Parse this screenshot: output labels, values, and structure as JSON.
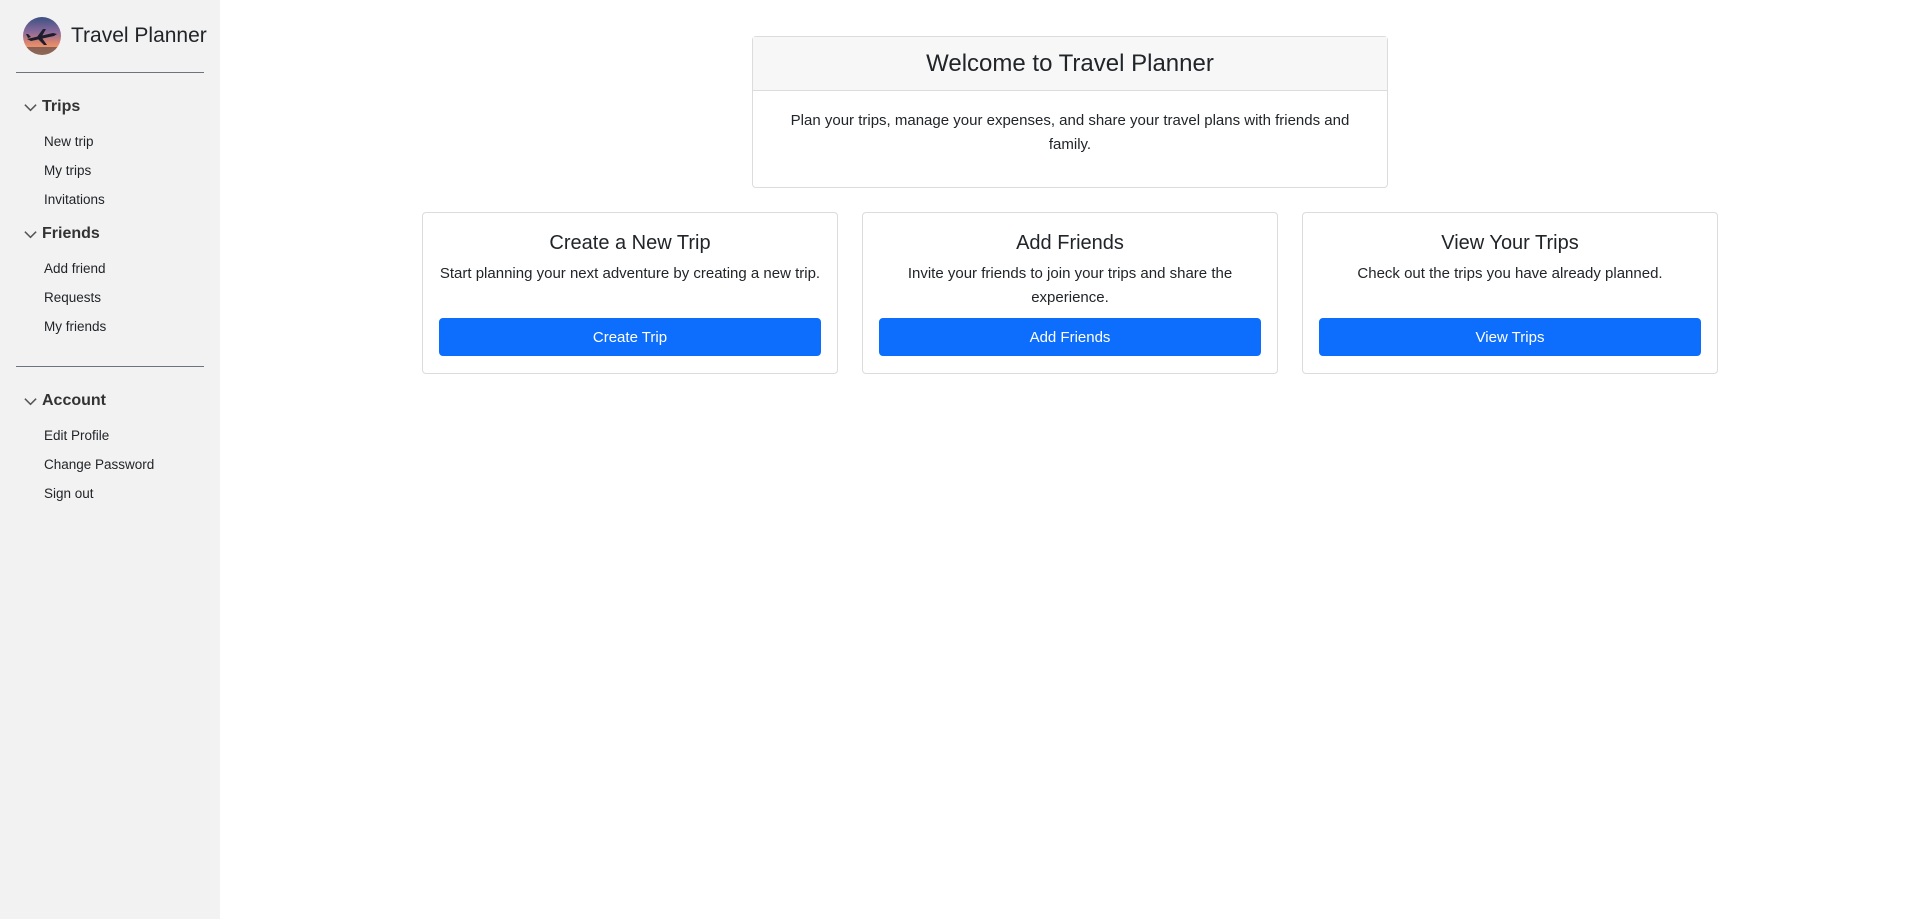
{
  "brand": {
    "title": "Travel Planner",
    "logo_icon": "airplane-sunset-logo"
  },
  "sidebar": {
    "sections": [
      {
        "title": "Trips",
        "icon": "chevron-down-icon",
        "items": [
          "New trip",
          "My trips",
          "Invitations"
        ]
      },
      {
        "title": "Friends",
        "icon": "chevron-down-icon",
        "items": [
          "Add friend",
          "Requests",
          "My friends"
        ]
      },
      {
        "title": "Account",
        "icon": "chevron-down-icon",
        "items": [
          "Edit Profile",
          "Change Password",
          "Sign out"
        ]
      }
    ]
  },
  "welcome": {
    "title": "Welcome to Travel Planner",
    "text": "Plan your trips, manage your expenses, and share your travel plans with friends and family."
  },
  "cards": [
    {
      "title": "Create a New Trip",
      "text": "Start planning your next adventure by creating a new trip.",
      "button": "Create Trip"
    },
    {
      "title": "Add Friends",
      "text": "Invite your friends to join your trips and share the experience.",
      "button": "Add Friends"
    },
    {
      "title": "View Your Trips",
      "text": "Check out the trips you have already planned.",
      "button": "View Trips"
    }
  ],
  "colors": {
    "primary": "#0d6efd",
    "sidebar_bg": "#f2f2f2",
    "card_border": "#dcdcdc"
  }
}
